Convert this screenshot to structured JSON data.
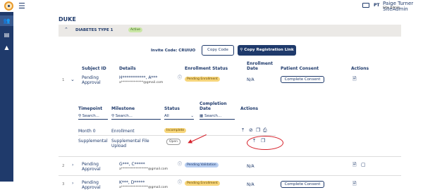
{
  "header": {
    "user_initials": "PT",
    "user_name": "Paige Turner SiteAdmin",
    "user_role": "Site Admin"
  },
  "sidebar": {
    "items": [
      {
        "icon": "users-icon"
      },
      {
        "icon": "document-icon"
      },
      {
        "icon": "person-icon"
      }
    ]
  },
  "site_name": "DUKE",
  "study": {
    "title": "DIABETES TYPE 1",
    "status": "Active"
  },
  "invite": {
    "label": "Invite Code: CRUIUO",
    "copy_code": "Copy Code",
    "copy_link": "Copy Registration Link"
  },
  "table": {
    "headers": {
      "subject_id": "Subject ID",
      "details": "Details",
      "enrollment_status": "Enrollment Status",
      "enrollment_date": "Enrollment Date",
      "patient_consent": "Patient Consent",
      "actions": "Actions"
    },
    "rows": [
      {
        "num": "1",
        "subject": "Pending Approval",
        "name": "H***********, A***",
        "email": "a**************@gmail.com",
        "status": "Pending Enrollment",
        "date": "N/A",
        "consent": "Complete Consent"
      },
      {
        "num": "2",
        "subject": "Pending Approval",
        "name": "G***, C*****",
        "email": "a*****************@gmail.com",
        "status": "Pending Validation",
        "date": "N/A",
        "consent": ""
      },
      {
        "num": "3",
        "subject": "Pending Approval",
        "name": "K***, D*****",
        "email": "a*****************@gmail.com",
        "status": "Pending Enrollment",
        "date": "N/A",
        "consent": "Complete Consent"
      }
    ]
  },
  "subtable": {
    "headers": {
      "timepoint": "Timepoint",
      "milestone": "Milestone",
      "status": "Status",
      "completion_date": "Completion Date",
      "actions": "Actions"
    },
    "search_placeholder": "Search...",
    "status_filter": "All",
    "rows": [
      {
        "timepoint": "Month 0",
        "milestone": "Enrollment",
        "status": "Incomplete"
      },
      {
        "timepoint": "Supplemental",
        "milestone": "Supplemental File Upload",
        "status": "Open"
      }
    ]
  }
}
